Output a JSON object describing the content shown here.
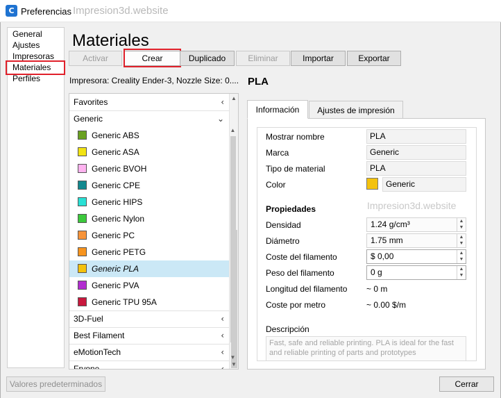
{
  "window": {
    "title": "Preferencias",
    "watermark": "Impresion3d.website",
    "app_icon_letter": "C"
  },
  "sidebar": {
    "items": [
      {
        "label": "General"
      },
      {
        "label": "Ajustes"
      },
      {
        "label": "Impresoras"
      },
      {
        "label": "Materiales",
        "selected": true
      },
      {
        "label": "Perfiles"
      }
    ]
  },
  "page": {
    "title": "Materiales"
  },
  "toolbar": {
    "activar": "Activar",
    "crear": "Crear",
    "duplicado": "Duplicado",
    "eliminar": "Eliminar",
    "importar": "Importar",
    "exportar": "Exportar"
  },
  "printer_info": "Impresora: Creality Ender-3, Nozzle Size: 0....",
  "materials_list": {
    "groups": [
      {
        "label": "Favorites",
        "chevron": "‹"
      },
      {
        "label": "Generic",
        "chevron": "⌄"
      }
    ],
    "items": [
      {
        "label": "Generic ABS",
        "color": "#6aa121"
      },
      {
        "label": "Generic ASA",
        "color": "#f2e313"
      },
      {
        "label": "Generic BVOH",
        "color": "#ffb3f0"
      },
      {
        "label": "Generic CPE",
        "color": "#13898f"
      },
      {
        "label": "Generic HIPS",
        "color": "#29e0d5"
      },
      {
        "label": "Generic Nylon",
        "color": "#3cc93c"
      },
      {
        "label": "Generic PC",
        "color": "#f7943a"
      },
      {
        "label": "Generic PETG",
        "color": "#f7941e"
      },
      {
        "label": "Generic PLA",
        "color": "#f4c20d",
        "selected": true
      },
      {
        "label": "Generic PVA",
        "color": "#b22ed0"
      },
      {
        "label": "Generic TPU 95A",
        "color": "#c8183d"
      }
    ],
    "brands": [
      {
        "label": "3D-Fuel",
        "chevron": "‹"
      },
      {
        "label": "Best Filament",
        "chevron": "‹"
      },
      {
        "label": "eMotionTech",
        "chevron": "‹"
      },
      {
        "label": "Fryone",
        "chevron": "‹"
      }
    ]
  },
  "detail": {
    "material_name": "PLA",
    "tabs": [
      {
        "label": "Información",
        "active": true
      },
      {
        "label": "Ajustes de impresión",
        "active": false
      }
    ],
    "fields": {
      "mostrar_nombre_label": "Mostrar nombre",
      "mostrar_nombre_value": "PLA",
      "marca_label": "Marca",
      "marca_value": "Generic",
      "tipo_label": "Tipo de material",
      "tipo_value": "PLA",
      "color_label": "Color",
      "color_value": "Generic",
      "color_hex": "#f4c20d"
    },
    "properties": {
      "heading": "Propiedades",
      "watermark": "Impresion3d.website",
      "densidad_label": "Densidad",
      "densidad_value": "1.24 g/cm³",
      "diametro_label": "Diámetro",
      "diametro_value": "1.75 mm",
      "coste_label": "Coste del filamento",
      "coste_value": "$ 0,00",
      "peso_label": "Peso del filamento",
      "peso_value": "0 g",
      "longitud_label": "Longitud del filamento",
      "longitud_value": "~ 0 m",
      "coste_metro_label": "Coste por metro",
      "coste_metro_value": "~ 0.00 $/m"
    },
    "description": {
      "label": "Descripción",
      "text": "Fast, safe and reliable printing. PLA is ideal for the fast and reliable printing of parts and prototypes"
    }
  },
  "footer": {
    "defaults_button": "Valores predeterminados",
    "close_button": "Cerrar"
  },
  "colors": {
    "highlight_red": "#e0202a",
    "selection_blue": "#cbe8f6",
    "app_blue": "#1f73d1"
  }
}
